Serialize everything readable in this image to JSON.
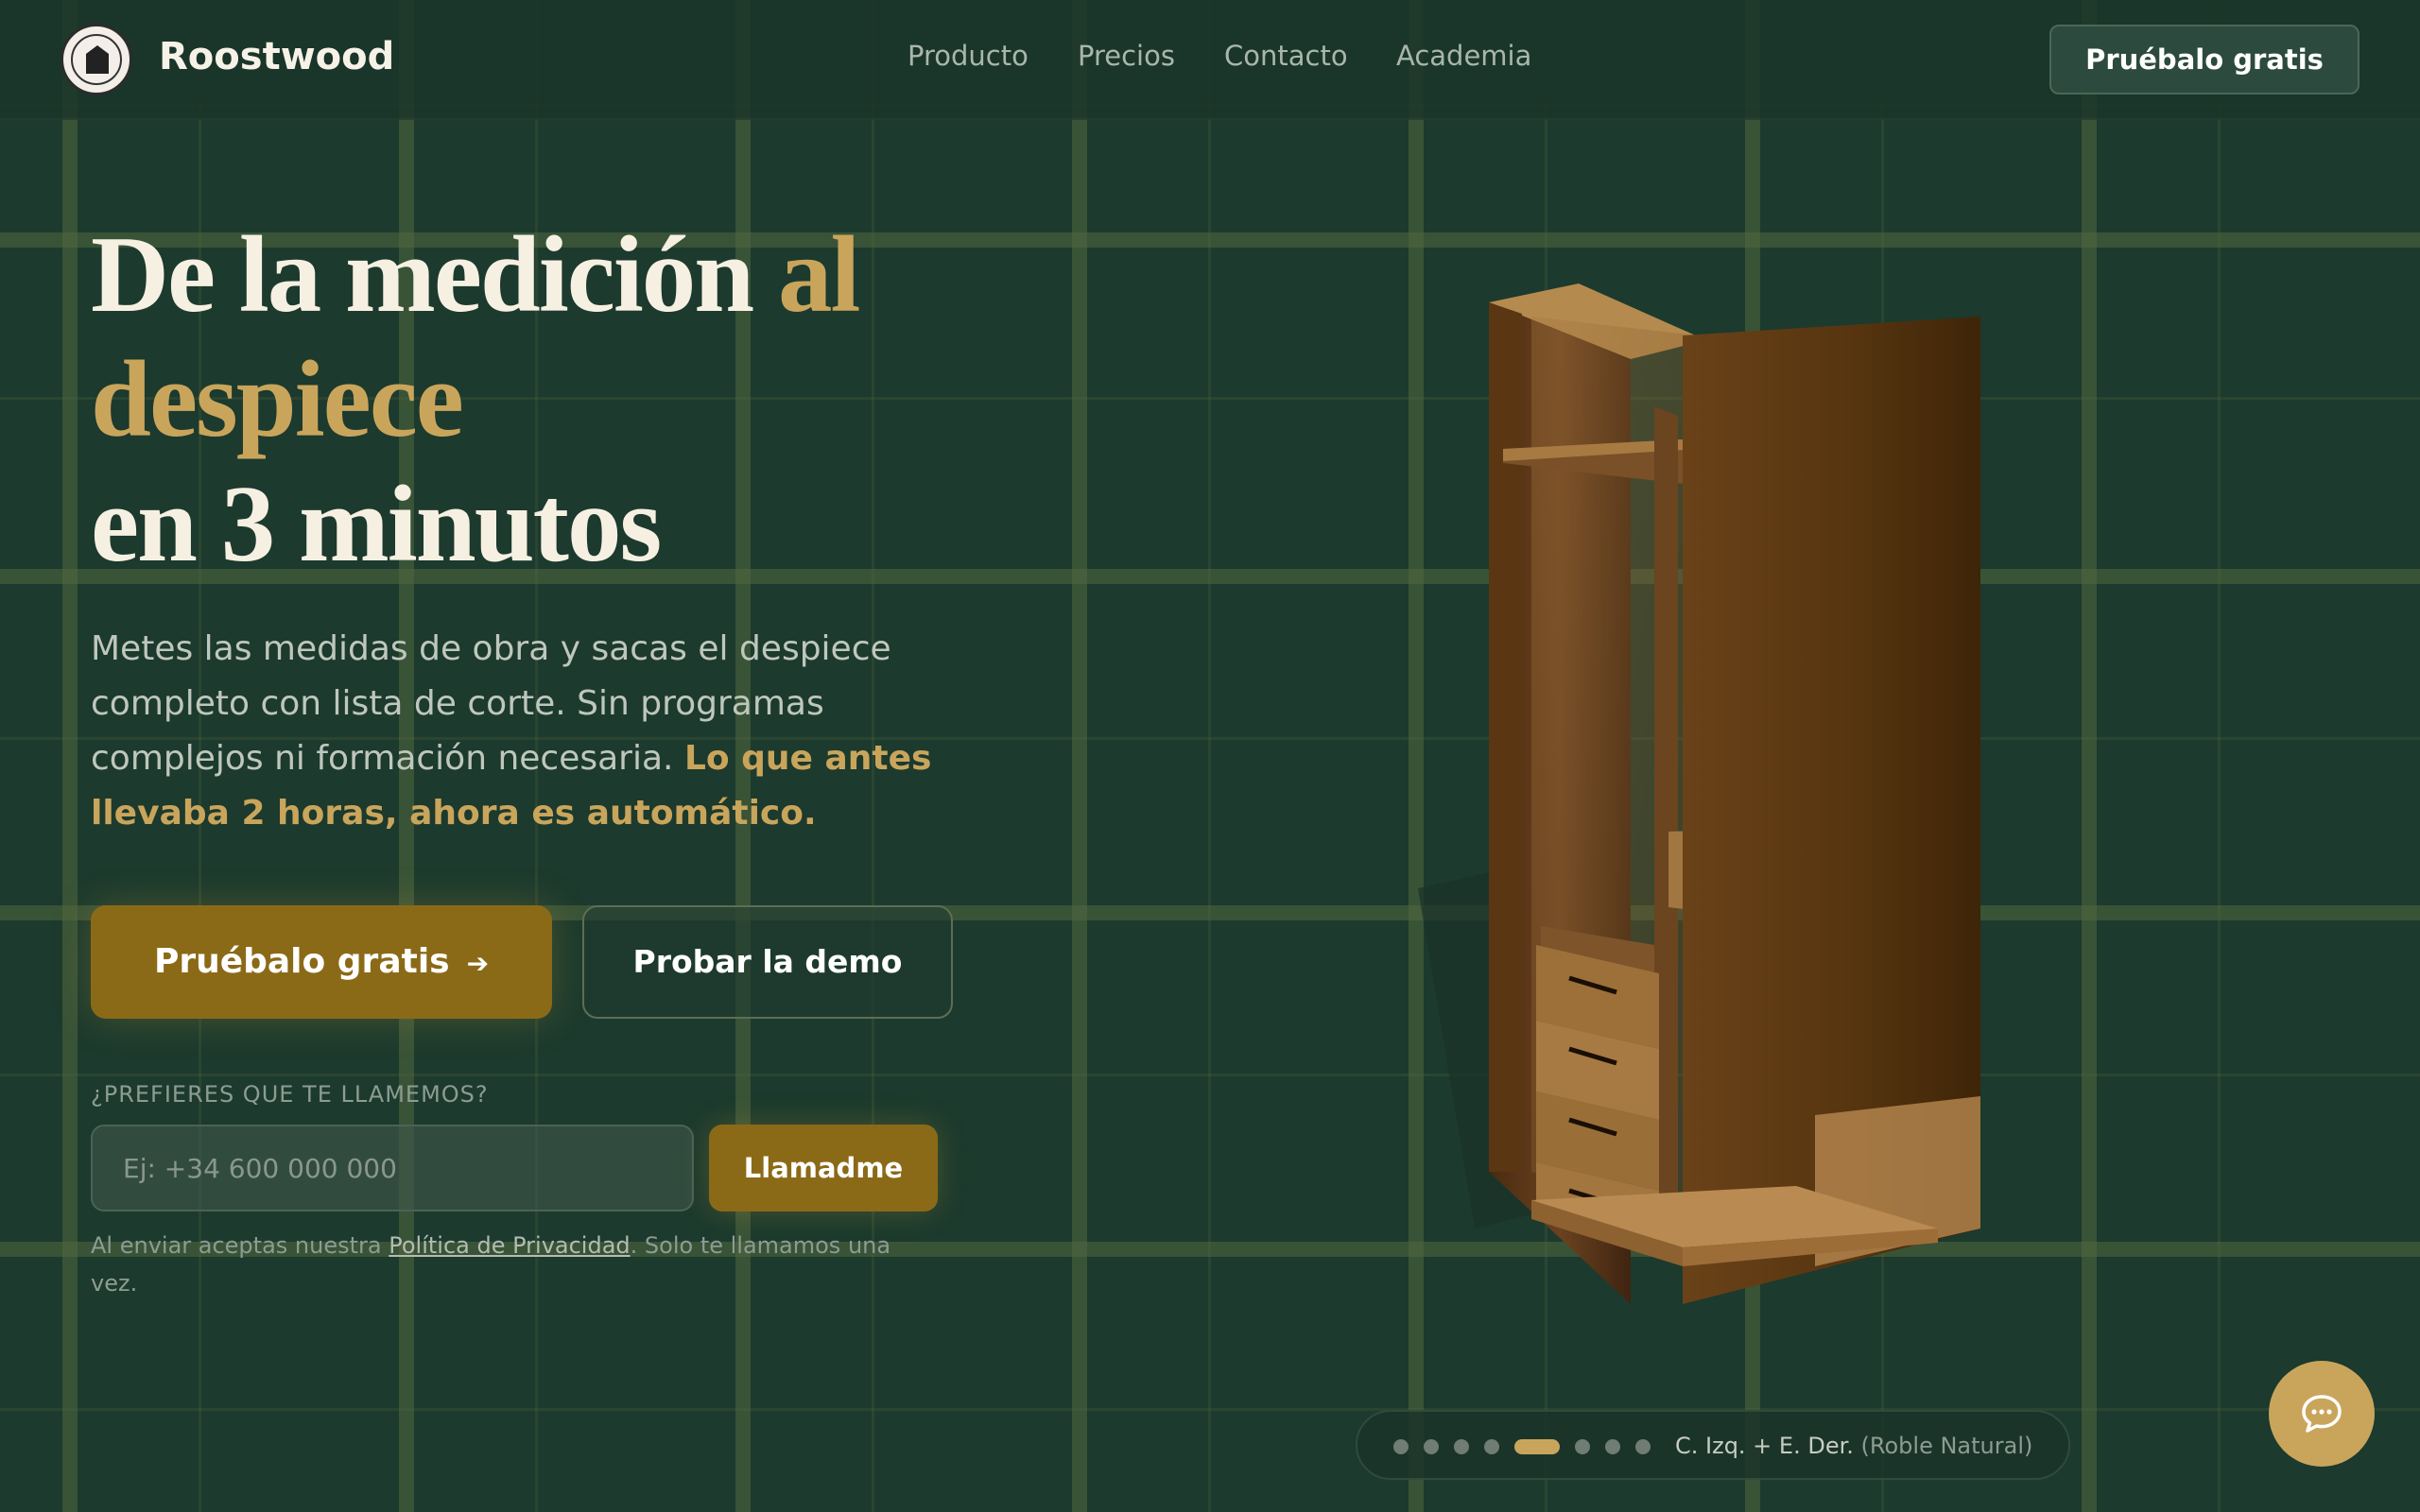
{
  "brand": {
    "name": "Roostwood"
  },
  "nav": {
    "items": [
      "Producto",
      "Precios",
      "Contacto",
      "Academia"
    ],
    "cta": "Pruébalo gratis"
  },
  "hero": {
    "title": {
      "part1": "De la medición ",
      "part2": "al",
      "part3": "despiece",
      "part4": "en 3 minutos"
    },
    "subtitle": {
      "text": "Metes las medidas de obra y sacas el despiece completo con lista de corte. Sin programas complejos ni formación necesaria. ",
      "highlight": "Lo que antes llevaba 2 horas, ahora es automático."
    },
    "primary_cta": "Pruébalo gratis",
    "secondary_cta": "Probar la demo"
  },
  "callback": {
    "label": "¿PREFIERES QUE TE LLAMEMOS?",
    "placeholder": "Ej: +34 600 000 000",
    "button": "Llamadme",
    "legal_pre": "Al enviar aceptas nuestra ",
    "legal_link": "Política de Privacidad",
    "legal_post": ". Solo te llamamos una vez."
  },
  "carousel": {
    "dot_count": 8,
    "active_index": 4,
    "caption": "C. Izq. + E. Der.",
    "caption_material": "(Roble Natural)"
  },
  "colors": {
    "bg": "#1c3a2d",
    "gold": "#c9a55c",
    "button": "#8b6a17"
  },
  "icons": {
    "chat": "chat-bubble-icon",
    "arrow": "arrow-right-icon"
  }
}
